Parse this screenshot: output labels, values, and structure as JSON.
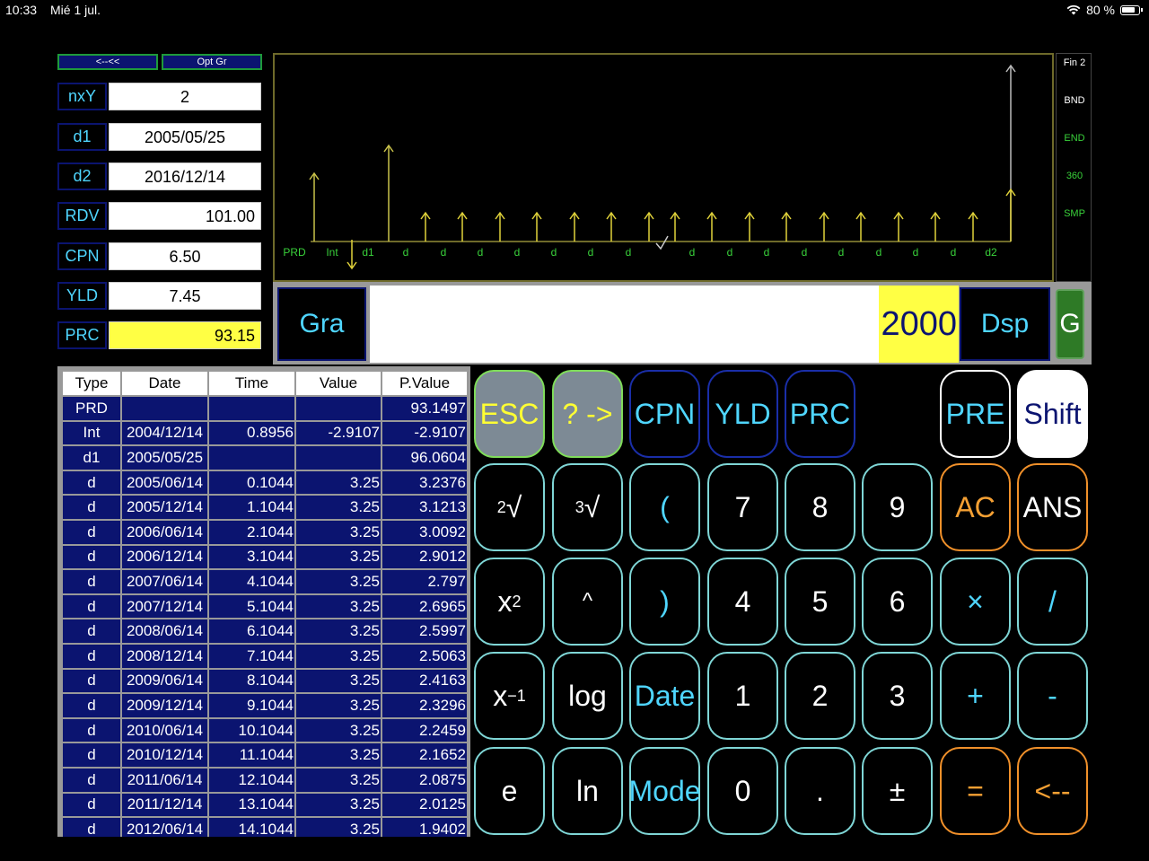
{
  "status_bar": {
    "time": "10:33",
    "date": "Mié 1 jul.",
    "battery": "80 %"
  },
  "nav": {
    "back_label": "<--<<",
    "opt_label": "Opt Gr"
  },
  "params": [
    {
      "label": "nxY",
      "value": "2"
    },
    {
      "label": "d1",
      "value": "2005/05/25"
    },
    {
      "label": "d2",
      "value": "2016/12/14"
    },
    {
      "label": "RDV",
      "value": "101.00"
    },
    {
      "label": "CPN",
      "value": "6.50"
    },
    {
      "label": "YLD",
      "value": "7.45"
    },
    {
      "label": "PRC",
      "value": "93.15"
    }
  ],
  "chart": {
    "labels": [
      "PRD",
      "Int",
      "d1",
      "d",
      "d",
      "d",
      "d",
      "d",
      "d",
      "d",
      "d",
      "d",
      "d",
      "d",
      "d",
      "d",
      "d",
      "d",
      "d2"
    ]
  },
  "side_menu": [
    "Fin 2",
    "BND",
    "END",
    "360",
    "SMP"
  ],
  "display": {
    "gra_label": "Gra",
    "value": "2000",
    "dsp_label": "Dsp",
    "g_label": "G"
  },
  "table": {
    "headers": [
      "Type",
      "Date",
      "Time",
      "Value",
      "P.Value"
    ],
    "rows": [
      [
        "PRD",
        "",
        "",
        "",
        "93.1497"
      ],
      [
        "Int",
        "2004/12/14",
        "0.8956",
        "-2.9107",
        "-2.9107"
      ],
      [
        "d1",
        "2005/05/25",
        "",
        "",
        "96.0604"
      ],
      [
        "d",
        "2005/06/14",
        "0.1044",
        "3.25",
        "3.2376"
      ],
      [
        "d",
        "2005/12/14",
        "1.1044",
        "3.25",
        "3.1213"
      ],
      [
        "d",
        "2006/06/14",
        "2.1044",
        "3.25",
        "3.0092"
      ],
      [
        "d",
        "2006/12/14",
        "3.1044",
        "3.25",
        "2.9012"
      ],
      [
        "d",
        "2007/06/14",
        "4.1044",
        "3.25",
        "2.797"
      ],
      [
        "d",
        "2007/12/14",
        "5.1044",
        "3.25",
        "2.6965"
      ],
      [
        "d",
        "2008/06/14",
        "6.1044",
        "3.25",
        "2.5997"
      ],
      [
        "d",
        "2008/12/14",
        "7.1044",
        "3.25",
        "2.5063"
      ],
      [
        "d",
        "2009/06/14",
        "8.1044",
        "3.25",
        "2.4163"
      ],
      [
        "d",
        "2009/12/14",
        "9.1044",
        "3.25",
        "2.3296"
      ],
      [
        "d",
        "2010/06/14",
        "10.1044",
        "3.25",
        "2.2459"
      ],
      [
        "d",
        "2010/12/14",
        "11.1044",
        "3.25",
        "2.1652"
      ],
      [
        "d",
        "2011/06/14",
        "12.1044",
        "3.25",
        "2.0875"
      ],
      [
        "d",
        "2011/12/14",
        "13.1044",
        "3.25",
        "2.0125"
      ],
      [
        "d",
        "2012/06/14",
        "14.1044",
        "3.25",
        "1.9402"
      ]
    ]
  },
  "keys": {
    "row1": [
      "ESC",
      "? ->",
      "CPN",
      "YLD",
      "PRC",
      "PRE",
      "Shift"
    ],
    "row2": [
      "√",
      "√",
      "(",
      "7",
      "8",
      "9",
      "AC",
      "ANS"
    ],
    "row3": [
      "x",
      "^",
      ")",
      "4",
      "5",
      "6",
      "×",
      "/"
    ],
    "row4": [
      "x",
      "log",
      "Date",
      "1",
      "2",
      "3",
      "+",
      "-"
    ],
    "row5": [
      "e",
      "ln",
      "Mode",
      "0",
      ".",
      "±",
      "=",
      "<--"
    ],
    "sup_sqrt2": "2",
    "sup_sqrt3": "3",
    "sup_sq": "2",
    "sup_inv": "−1"
  }
}
